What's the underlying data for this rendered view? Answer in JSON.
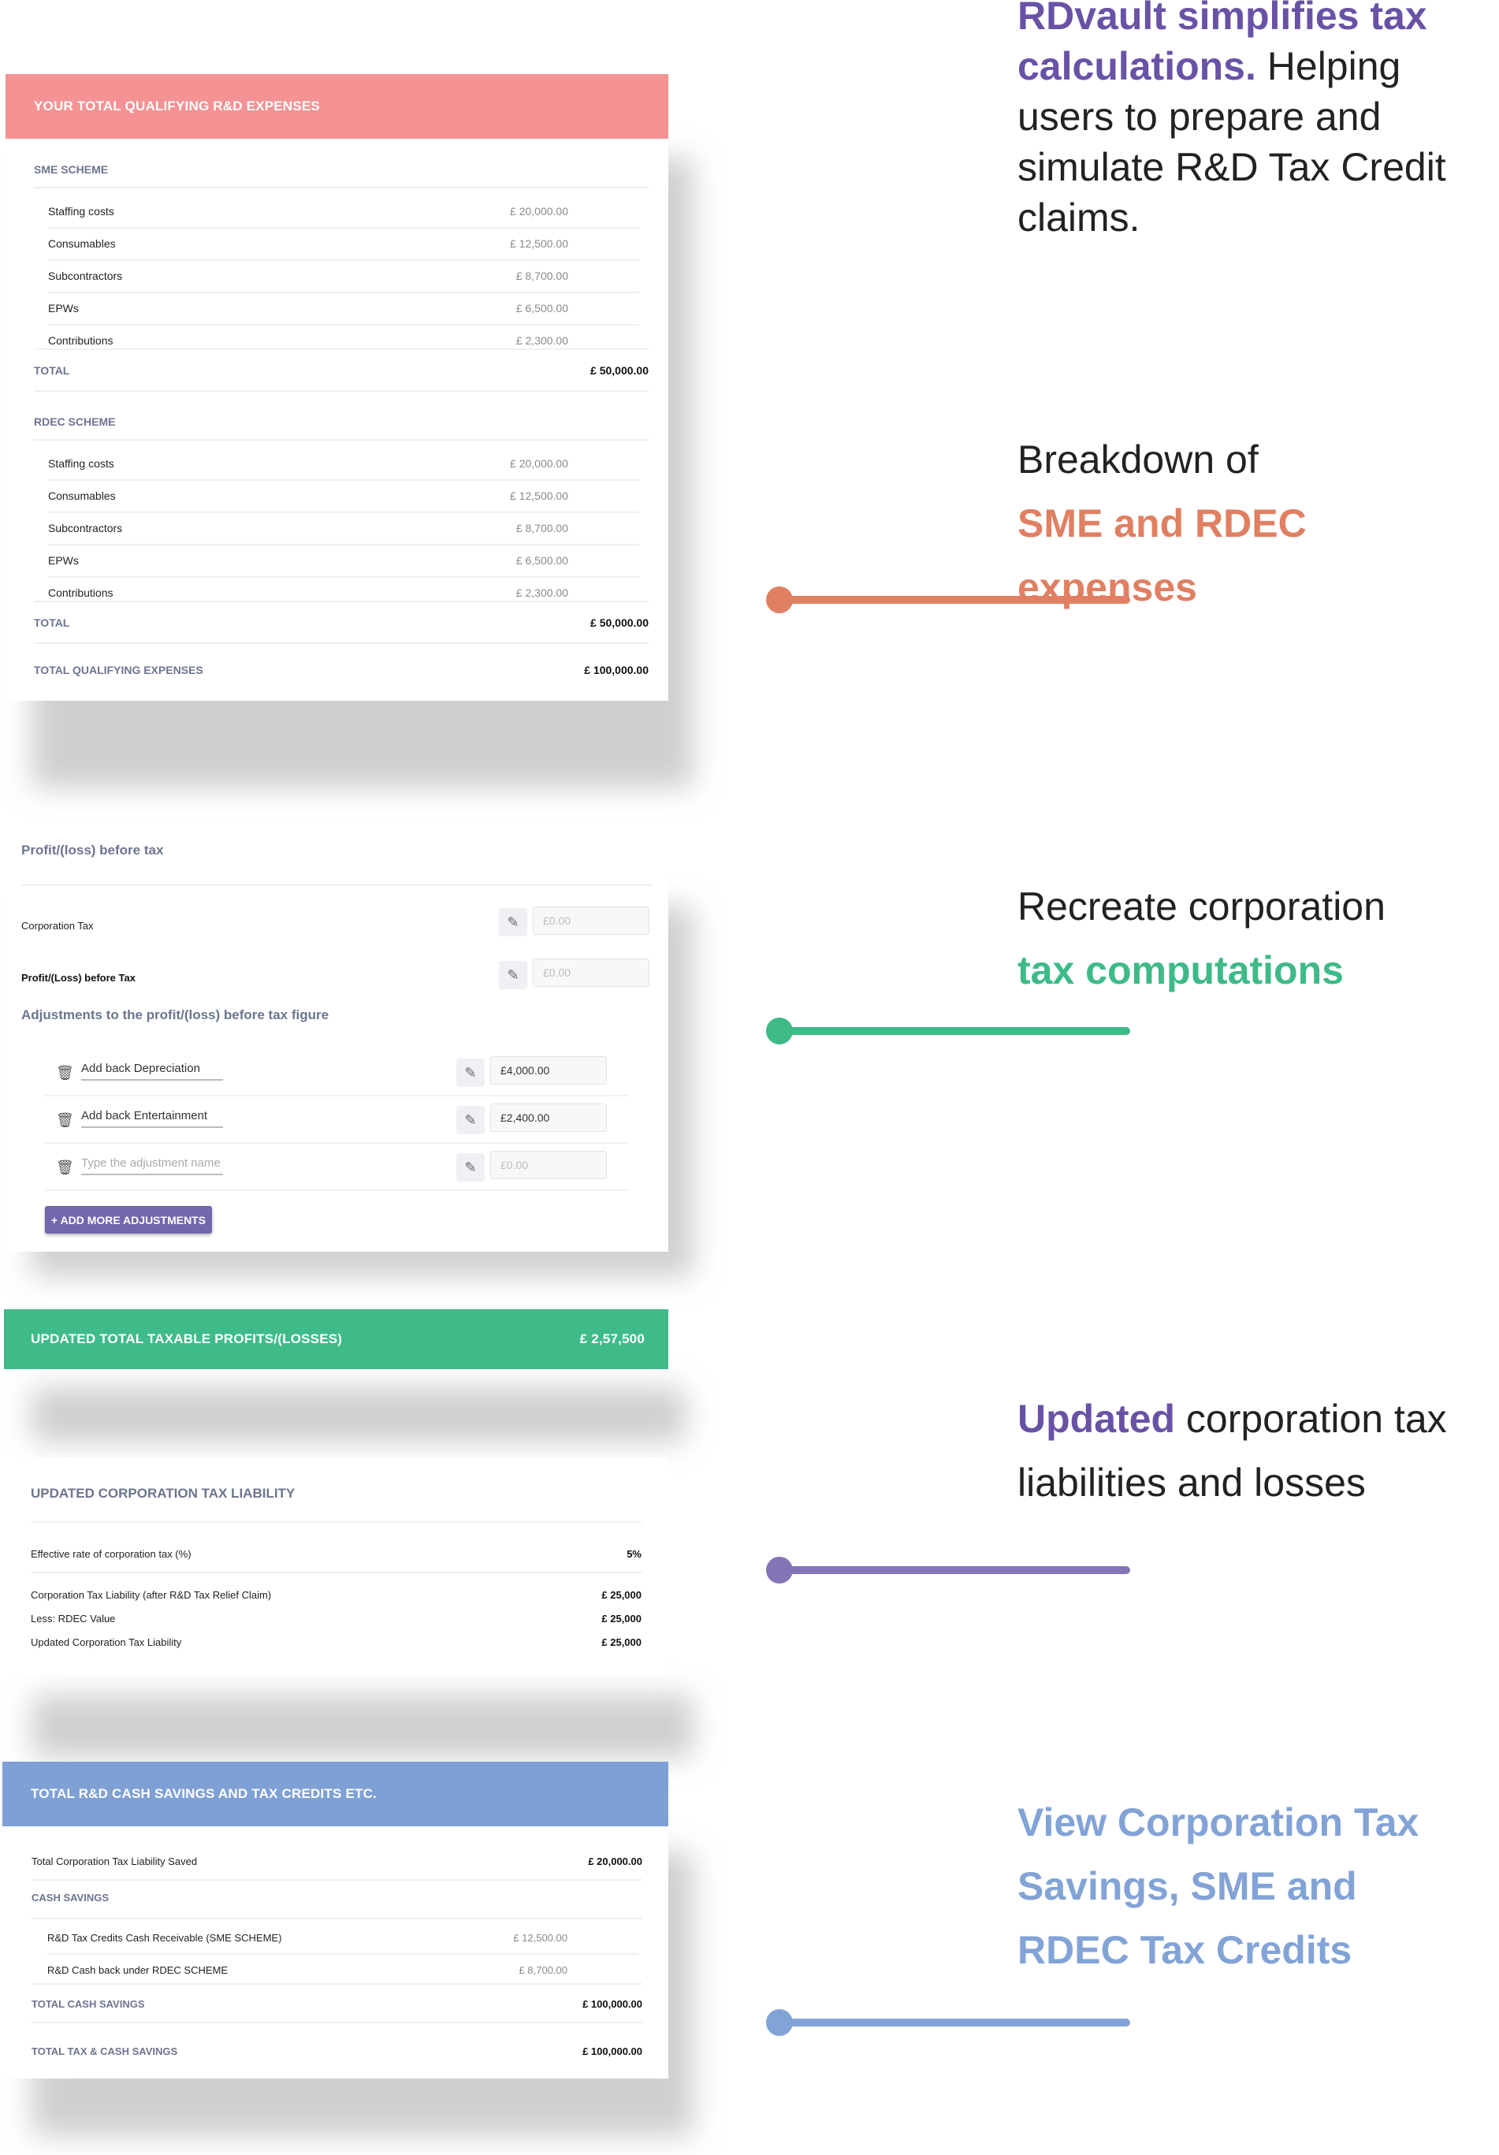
{
  "colors": {
    "purple": "#6952a6",
    "orange": "#e07f61",
    "green": "#3eba87",
    "blue": "#82a3d6",
    "pink_header": "#f49294",
    "green_bar": "#3fbb89",
    "blue_header": "#7fa0d4",
    "button": "#7266ad"
  },
  "callouts": [
    {
      "highlight": "RDvault simplifies tax calculations.",
      "text": " Helping users to prepare and simulate R&D Tax Credit claims."
    },
    {
      "line1": "Breakdown of",
      "highlight": "SME and RDEC expenses"
    },
    {
      "line1": "Recreate corporation",
      "highlight": "tax computations"
    },
    {
      "highlight": "Updated",
      "text": " corporation tax liabilities and losses"
    },
    {
      "highlight": "View Corporation Tax Savings, SME and RDEC Tax Credits"
    }
  ],
  "expenses": {
    "header": "YOUR TOTAL QUALIFYING R&D EXPENSES",
    "sme": {
      "label": "SME SCHEME",
      "items": [
        {
          "label": "Staffing costs",
          "value": "£ 20,000.00"
        },
        {
          "label": "Consumables",
          "value": "£ 12,500.00"
        },
        {
          "label": "Subcontractors",
          "value": "£ 8,700.00"
        },
        {
          "label": "EPWs",
          "value": "£ 6,500.00"
        },
        {
          "label": "Contributions",
          "value": "£ 2,300.00"
        }
      ],
      "total_label": "TOTAL",
      "total_value": "£ 50,000.00"
    },
    "rdec": {
      "label": "RDEC SCHEME",
      "items": [
        {
          "label": "Staffing costs",
          "value": "£ 20,000.00"
        },
        {
          "label": "Consumables",
          "value": "£ 12,500.00"
        },
        {
          "label": "Subcontractors",
          "value": "£ 8,700.00"
        },
        {
          "label": "EPWs",
          "value": "£ 6,500.00"
        },
        {
          "label": "Contributions",
          "value": "£ 2,300.00"
        }
      ],
      "total_label": "TOTAL",
      "total_value": "£ 50,000.00"
    },
    "grand_total_label": "TOTAL QUALIFYING EXPENSES",
    "grand_total_value": "£ 100,000.00"
  },
  "profit": {
    "title": "Profit/(loss) before tax",
    "corporation_tax_label": "Corporation Tax",
    "corporation_tax_value": "£0.00",
    "profit_before_tax_label": "Profit/(Loss) before Tax",
    "profit_before_tax_value": "£0.00",
    "adjustments_title": "Adjustments to the profit/(loss) before tax figure",
    "adjustments": [
      {
        "name": "Add back Depreciation",
        "value": "£4,000.00"
      },
      {
        "name": "Add back Entertainment",
        "value": "£2,400.00"
      },
      {
        "name": "",
        "placeholder": "Type the adjustment name",
        "value": "",
        "value_placeholder": "£0.00"
      }
    ],
    "add_button": "+ ADD MORE ADJUSTMENTS"
  },
  "taxable": {
    "label": "UPDATED TOTAL TAXABLE PROFITS/(LOSSES)",
    "value": "£ 2,57,500"
  },
  "liability": {
    "title": "UPDATED CORPORATION TAX LIABILITY",
    "rate_label": "Effective rate of corporation tax (%)",
    "rate_value": "5%",
    "rows": [
      {
        "label": "Corporation Tax Liability (after R&D Tax Relief Claim)",
        "value": "£ 25,000"
      },
      {
        "label": "Less: RDEC Value",
        "value": "£ 25,000"
      },
      {
        "label": "Updated Corporation Tax Liability",
        "value": "£ 25,000"
      }
    ]
  },
  "savings": {
    "header": "TOTAL R&D CASH SAVINGS AND TAX CREDITS ETC.",
    "liability_saved_label": "Total Corporation Tax Liability Saved",
    "liability_saved_value": "£ 20,000.00",
    "cash_label": "CASH SAVINGS",
    "cash_items": [
      {
        "label": "R&D Tax Credits Cash Receivable (SME SCHEME)",
        "value": "£ 12,500.00"
      },
      {
        "label": "R&D Cash back under RDEC SCHEME",
        "value": "£ 8,700.00"
      }
    ],
    "total_cash_label": "TOTAL CASH SAVINGS",
    "total_cash_value": "£ 100,000.00",
    "total_all_label": "TOTAL TAX & CASH SAVINGS",
    "total_all_value": "£ 100,000.00"
  }
}
